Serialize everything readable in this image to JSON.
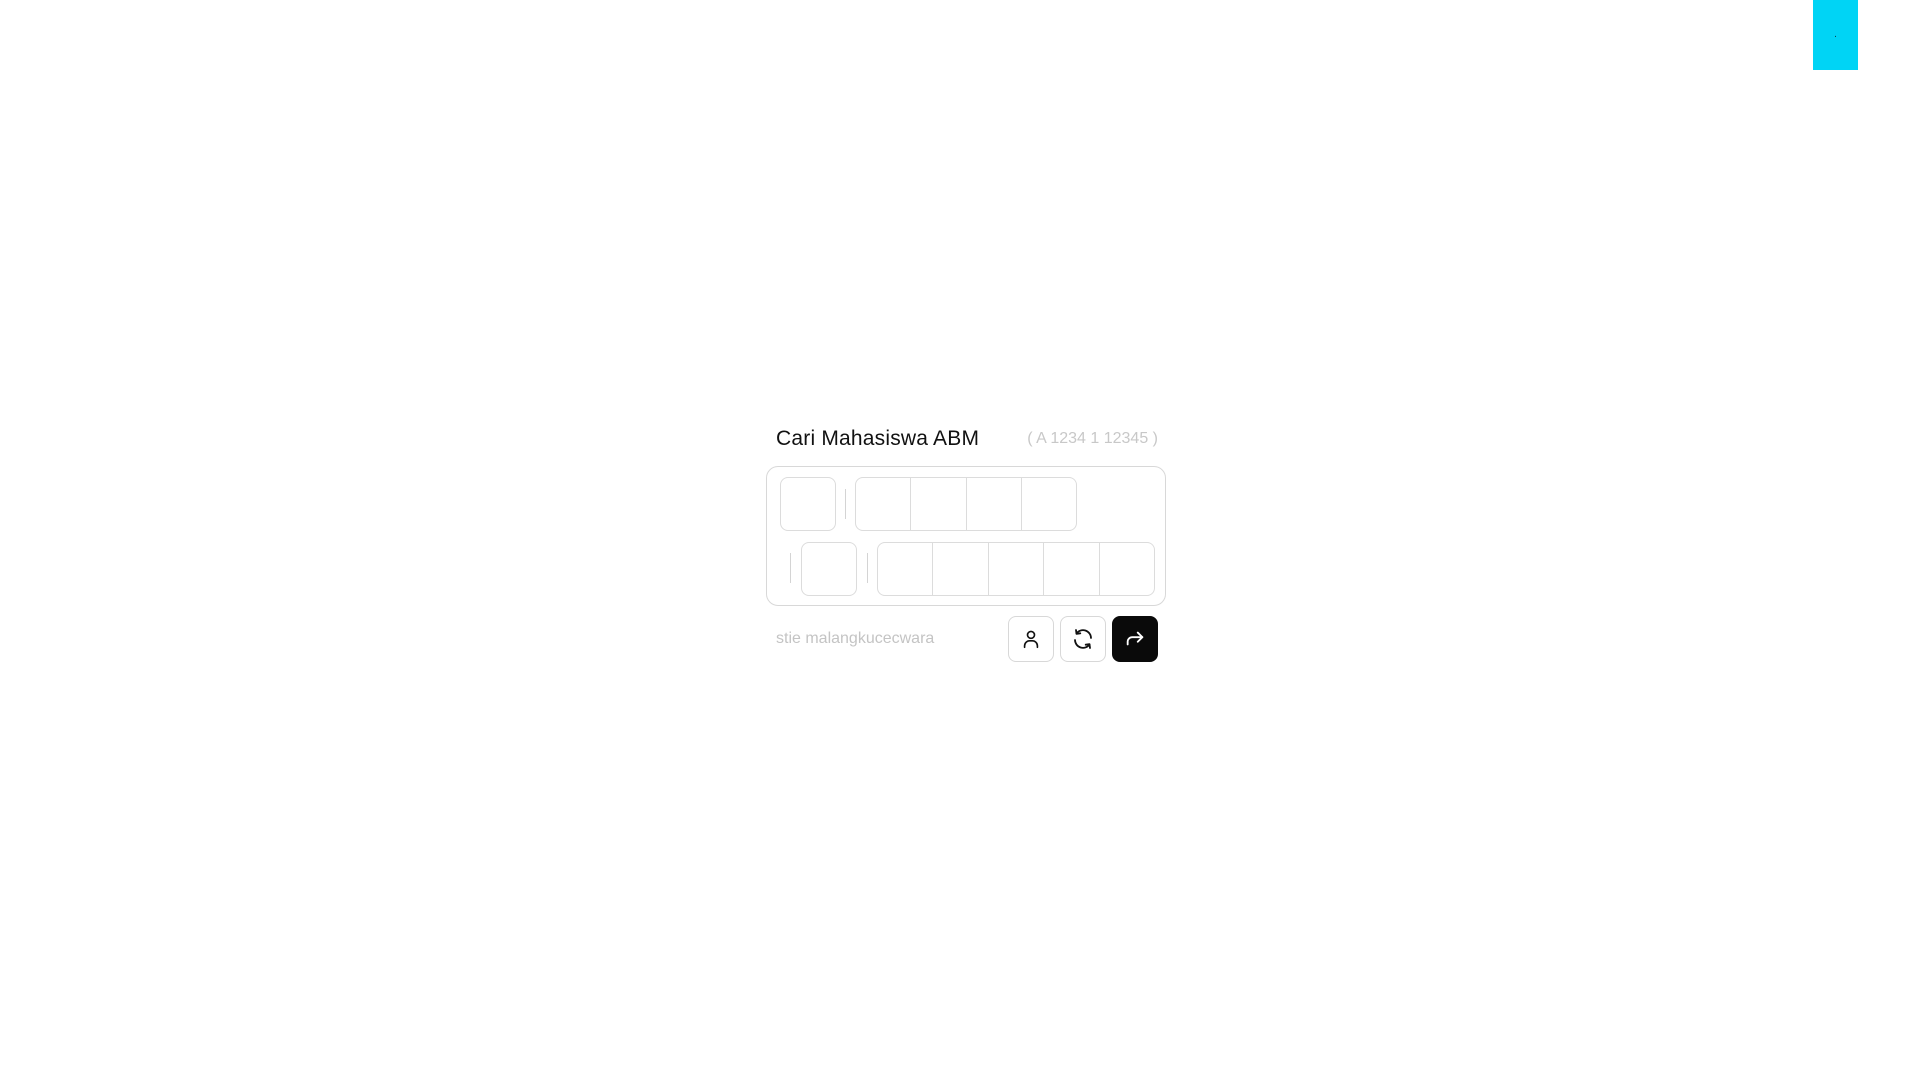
{
  "corner_tab": {
    "label": "."
  },
  "search": {
    "title": "Cari Mahasiswa ABM",
    "format_hint": "( A 1234 1 12345 )",
    "site_text": "stie malangkucecwara"
  },
  "icons": {
    "profile": "user-icon",
    "reset": "refresh-icon",
    "submit": "arrow-forward-icon"
  },
  "colors": {
    "accent_tab": "#00d4f5",
    "submit_button": "#0a0a0a"
  }
}
